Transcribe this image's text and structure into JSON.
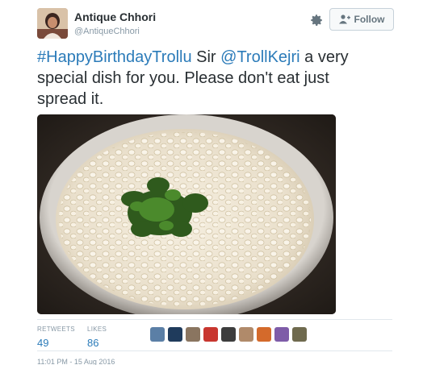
{
  "tweet": {
    "display_name": "Antique Chhori",
    "handle": "@AntiqueChhori",
    "follow_label": "Follow",
    "text_hashtag": "#HappyBirthdayTrollu",
    "text_part1": " Sir ",
    "text_mention": "@TrollKejri",
    "text_part2": " a very special dish for you. Please don't eat just spread it.",
    "retweets_label": "RETWEETS",
    "retweets_count": "49",
    "likes_label": "LIKES",
    "likes_count": "86",
    "timestamp": "11:01 PM - 15 Aug 2016"
  },
  "colors": {
    "link": "#2b7bb9",
    "text": "#292f33",
    "muted": "#8899a6"
  },
  "icons": {
    "settings": "gear-icon",
    "follow": "add-person-icon"
  }
}
